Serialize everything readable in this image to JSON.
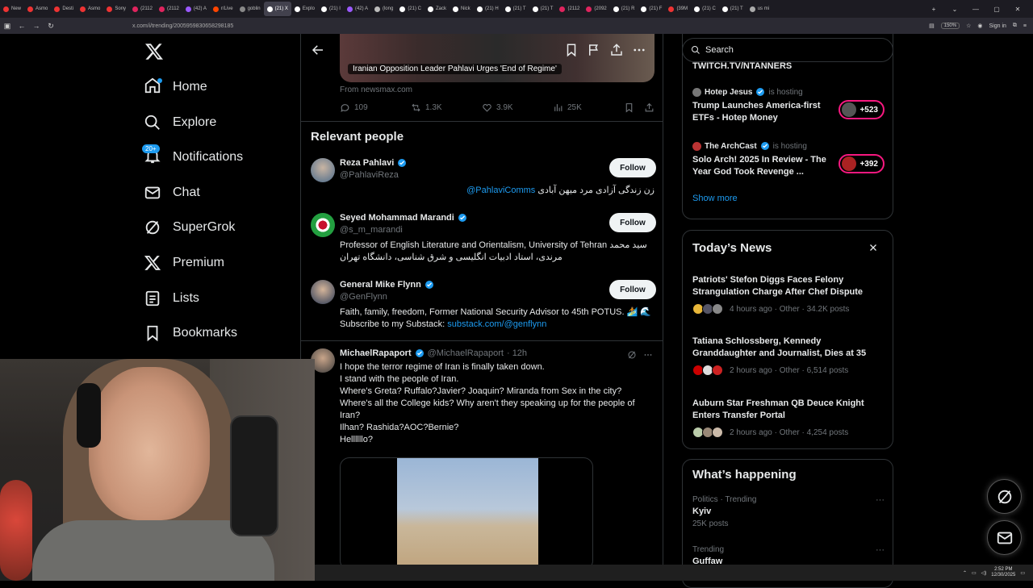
{
  "browser": {
    "tabs": [
      {
        "label": "New",
        "color": "#e33"
      },
      {
        "label": "Asmo",
        "color": "#e33"
      },
      {
        "label": "Desti",
        "color": "#e33"
      },
      {
        "label": "Asmo",
        "color": "#e33"
      },
      {
        "label": "Sony",
        "color": "#e33"
      },
      {
        "label": "(2112",
        "color": "#e0245e"
      },
      {
        "label": "(2112",
        "color": "#e0245e"
      },
      {
        "label": "(42) A",
        "color": "#9b59ff"
      },
      {
        "label": "r/Live",
        "color": "#ff4500"
      },
      {
        "label": "goblin",
        "color": "#888"
      },
      {
        "label": "(21) X",
        "color": "#fff",
        "active": true
      },
      {
        "label": "Explo",
        "color": "#fff"
      },
      {
        "label": "(21) I",
        "color": "#fff"
      },
      {
        "label": "(42) A",
        "color": "#9b59ff"
      },
      {
        "label": "(long",
        "color": "#bbb"
      },
      {
        "label": "(21) C",
        "color": "#fff"
      },
      {
        "label": "Zack",
        "color": "#fff"
      },
      {
        "label": "Nick",
        "color": "#fff"
      },
      {
        "label": "(21) H",
        "color": "#fff"
      },
      {
        "label": "(21) T",
        "color": "#fff"
      },
      {
        "label": "(21) T",
        "color": "#fff"
      },
      {
        "label": "(2112",
        "color": "#e0245e"
      },
      {
        "label": "(2092",
        "color": "#e0245e"
      },
      {
        "label": "(21) R",
        "color": "#fff"
      },
      {
        "label": "(21) F",
        "color": "#fff"
      },
      {
        "label": "(39M",
        "color": "#e33"
      },
      {
        "label": "(21) C",
        "color": "#fff"
      },
      {
        "label": "(21) T",
        "color": "#fff"
      },
      {
        "label": "us mi",
        "color": "#aaa"
      }
    ],
    "url": "x.com/i/trending/2005959830658298185",
    "zoom": "150%",
    "sign_in": "Sign in"
  },
  "sidebar": {
    "items": [
      {
        "label": "Home",
        "icon": "home-icon"
      },
      {
        "label": "Explore",
        "icon": "search-icon"
      },
      {
        "label": "Notifications",
        "icon": "bell-icon",
        "badge": "20+"
      },
      {
        "label": "Chat",
        "icon": "mail-icon"
      },
      {
        "label": "SuperGrok",
        "icon": "grok-icon"
      },
      {
        "label": "Premium",
        "icon": "x-icon"
      },
      {
        "label": "Lists",
        "icon": "list-icon"
      },
      {
        "label": "Bookmarks",
        "icon": "bookmark-icon"
      }
    ]
  },
  "article": {
    "caption": "Iranian Opposition Leader Pahlavi Urges 'End of Regime'",
    "source": "From newsmax.com",
    "replies": "109",
    "reposts": "1.3K",
    "likes": "3.9K",
    "views": "25K"
  },
  "relevant": {
    "title": "Relevant people",
    "follow_label": "Follow",
    "people": [
      {
        "name": "Reza Pahlavi",
        "handle": "@PahlaviReza",
        "bio_link": "@PahlaviComms",
        "bio": "زن زندگی آزادی مرد میهن آبادی"
      },
      {
        "name": "Seyed Mohammad Marandi",
        "handle": "@s_m_marandi",
        "bio": "Professor of English Literature and Orientalism, University of Tehran سید محمد مرندی، استاد ادبیات انگلیسی و شرق شناسی، دانشگاه تهران"
      },
      {
        "name": "General Mike Flynn",
        "handle": "@GenFlynn",
        "bio": "Faith, family, freedom, Former National Security Advisor to 45th POTUS. 🏄 🌊 Subscribe to my Substack:",
        "bio_link": "substack.com/@genflynn"
      }
    ]
  },
  "tweet": {
    "name": "MichaelRapaport",
    "handle": "@MichaelRapaport",
    "time": "· 12h",
    "body": "I hope the terror regime of Iran is finally taken down.\nI stand with the people of Iran.\nWhere's Greta? Ruffalo?Javier? Joaquin? Miranda from Sex in the city?\nWhere's all the College kids? Why aren't they speaking up for the people of Iran?\nIlhan? Rashida?AOC?Bernie?\nHellllllo?"
  },
  "right": {
    "search_placeholder": "Search",
    "live_top_partial": "TWITCH.TV/NTANNERS",
    "live": [
      {
        "host": "Hotep Jesus",
        "status": "is hosting",
        "title": "Trump Launches America-first ETFs - Hotep Money",
        "count": "+523"
      },
      {
        "host": "The ArchCast",
        "status": "is hosting",
        "title": "Solo Arch! 2025 In Review - The Year God Took Revenge ...",
        "count": "+392"
      }
    ],
    "show_more": "Show more",
    "news_title": "Today’s News",
    "news": [
      {
        "title": "Patriots' Stefon Diggs Faces Felony Strangulation Charge After Chef Dispute",
        "meta": "4 hours ago · Other · 34.2K posts"
      },
      {
        "title": "Tatiana Schlossberg, Kennedy Granddaughter and Journalist, Dies at 35",
        "meta": "2 hours ago · Other · 6,514 posts"
      },
      {
        "title": "Auburn Star Freshman QB Deuce Knight Enters Transfer Portal",
        "meta": "2 hours ago · Other · 4,254 posts"
      }
    ],
    "happening_title": "What’s happening",
    "trends": [
      {
        "category": "Politics · Trending",
        "name": "Kyiv",
        "posts": "25K posts"
      },
      {
        "category": "Trending",
        "name": "Guffaw",
        "posts": ""
      }
    ]
  },
  "taskbar": {
    "time": "2:52 PM",
    "date": "12/30/2025"
  },
  "colors": {
    "accent": "#1d9bf0",
    "live": "#f91880",
    "background": "#000000"
  }
}
